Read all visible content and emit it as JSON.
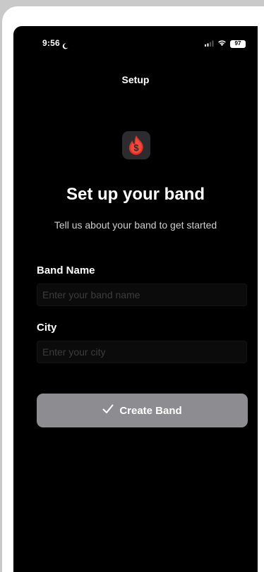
{
  "status_bar": {
    "time": "9:56",
    "battery": "97",
    "icons": [
      "moon-icon",
      "signal-icon",
      "wifi-icon",
      "battery-icon"
    ]
  },
  "nav": {
    "title": "Setup"
  },
  "app_icon": {
    "name": "flame-dollar-icon",
    "colors": {
      "background": "#2c2c2e",
      "flame": "#e0302a"
    }
  },
  "hero": {
    "title": "Set up your band",
    "subtitle": "Tell us about your band to get started"
  },
  "form": {
    "band_name": {
      "label": "Band Name",
      "placeholder": "Enter your band name",
      "value": ""
    },
    "city": {
      "label": "City",
      "placeholder": "Enter your city",
      "value": ""
    }
  },
  "create_button": {
    "label": "Create Band",
    "icon": "checkmark-icon",
    "state": "disabled"
  },
  "colors": {
    "screen_background": "#000000",
    "button_disabled": "#8d8d91",
    "accent": "#e0302a"
  }
}
